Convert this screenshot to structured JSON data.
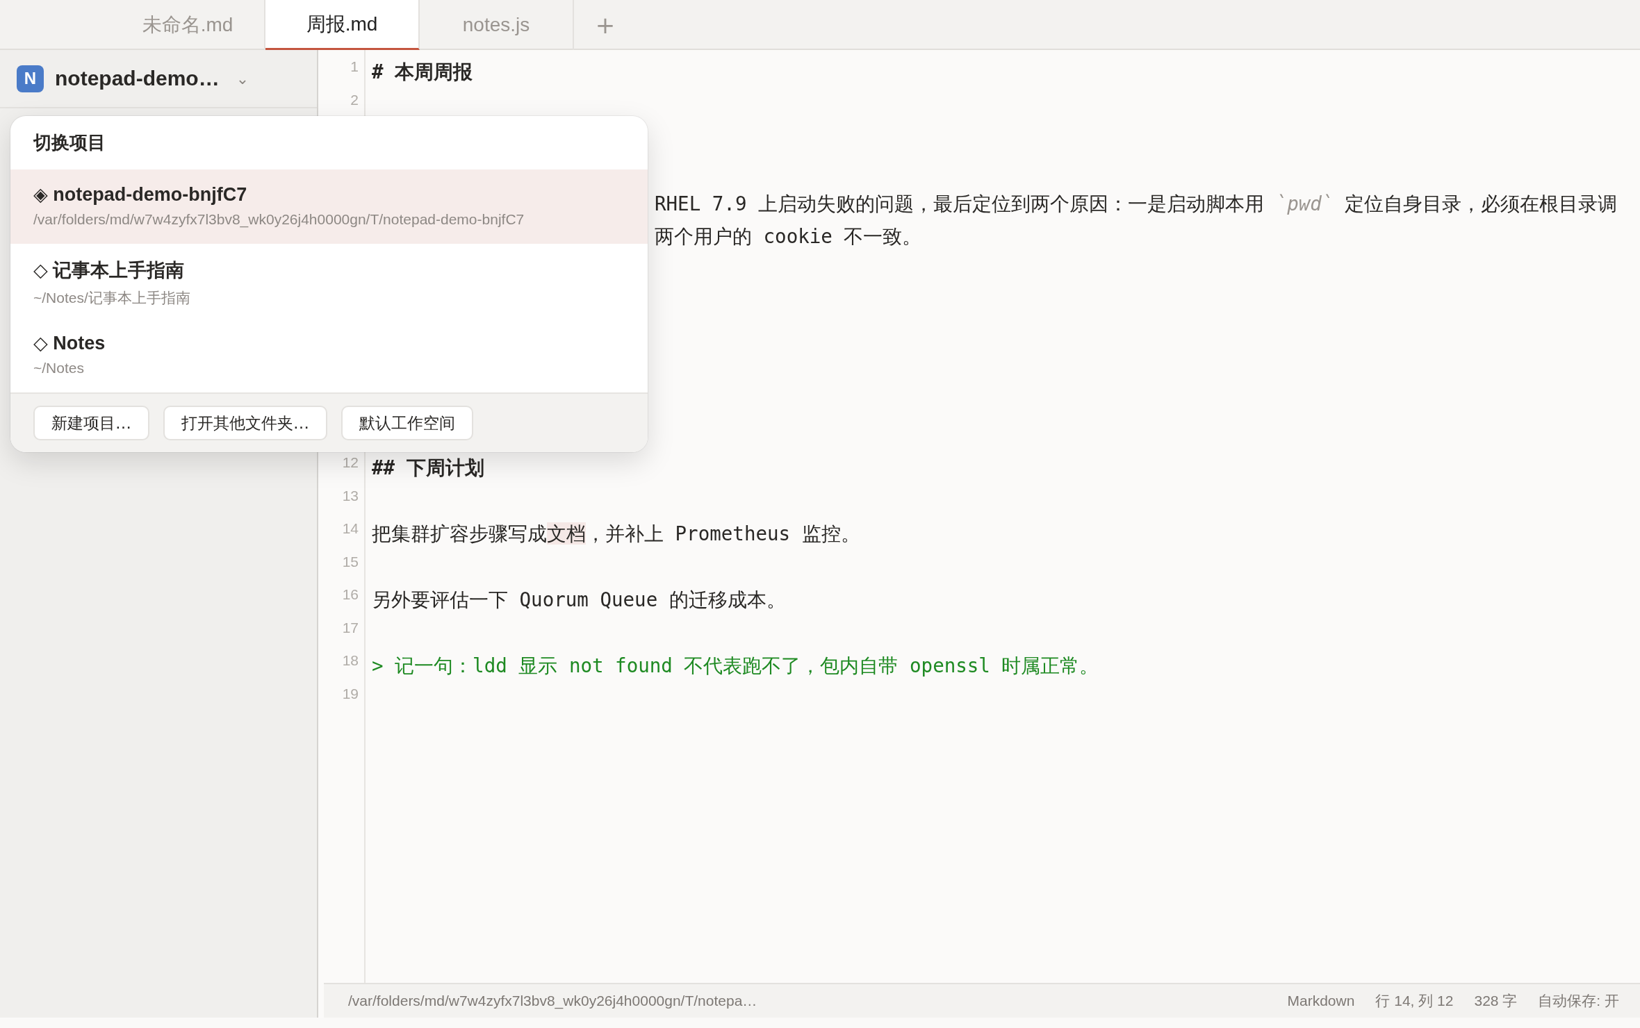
{
  "tabs": [
    {
      "label": "未命名.md",
      "selected": false
    },
    {
      "label": "周报.md",
      "selected": true
    },
    {
      "label": "notes.js",
      "selected": false
    }
  ],
  "new_tab": "+",
  "sidebar": {
    "logo": "N",
    "project": "notepad-demo…",
    "caret": "⌄"
  },
  "project_switcher": {
    "title": "切换项目",
    "projects": [
      {
        "marker": "◈",
        "name": "notepad-demo-bnjfC7",
        "path": "/var/folders/md/w7w4zyfx7l3bv8_wk0y26j4h0000gn/T/notepad-demo-bnjfC7",
        "selected": true
      },
      {
        "marker": "◇",
        "name": "记事本上手指南",
        "path": "~/Notes/记事本上手指南",
        "selected": false
      },
      {
        "marker": "◇",
        "name": "Notes",
        "path": "~/Notes",
        "selected": false
      }
    ],
    "buttons": [
      "新建项目…",
      "打开其他文件夹…",
      "默认工作空间"
    ]
  },
  "editor": {
    "rows": [
      {
        "kind": "heading",
        "number": "1",
        "segments": [
          {
            "text": "#  本周周报"
          }
        ]
      },
      {
        "kind": "plain",
        "number": "2"
      },
      {
        "kind": "covered"
      },
      {
        "kind": "covered"
      },
      {
        "kind": "covered",
        "segments": [
          {
            "text": "RHEL 7.9 上启动失败的问题，最后定位到两个原因：一是启动脚本用 "
          },
          {
            "text": "`pwd`",
            "kind": "code"
          },
          {
            "text": " 定位自身目录，必须在根目录调"
          }
        ]
      },
      {
        "kind": "covered",
        "segments": [
          {
            "text": "两个用户的 cookie 不一致。"
          }
        ]
      },
      {
        "kind": "covered"
      },
      {
        "kind": "covered"
      },
      {
        "kind": "covered"
      },
      {
        "kind": "covered"
      },
      {
        "kind": "covered"
      },
      {
        "kind": "covered"
      },
      {
        "kind": "heading",
        "number": "12",
        "segments": [
          {
            "text": "##  下周计划"
          }
        ]
      },
      {
        "kind": "plain",
        "number": "13"
      },
      {
        "kind": "plain",
        "number": "14",
        "segments": [
          {
            "text": "把集群扩容步骤写成"
          },
          {
            "text": "文档",
            "highlighted": true
          },
          {
            "text": "，并补上 Prometheus 监控。"
          }
        ]
      },
      {
        "kind": "plain",
        "number": "15"
      },
      {
        "kind": "plain",
        "number": "16",
        "segments": [
          {
            "text": "另外要评估一下 Quorum Queue 的迁移成本。"
          }
        ]
      },
      {
        "kind": "plain",
        "number": "17"
      },
      {
        "kind": "quote",
        "number": "18",
        "segments": [
          {
            "text": "> 记一句：ldd 显示 not found 不代表跑不了，包内自带 openssl 时属正常。"
          }
        ]
      },
      {
        "kind": "plain",
        "number": "19"
      }
    ]
  },
  "status_bar": {
    "path": "/var/folders/md/w7w4zyfx7l3bv8_wk0y26j4h0000gn/T/notepa…",
    "items": [
      "Markdown",
      "行 14, 列 12",
      "328 字",
      "自动保存: 开"
    ]
  }
}
